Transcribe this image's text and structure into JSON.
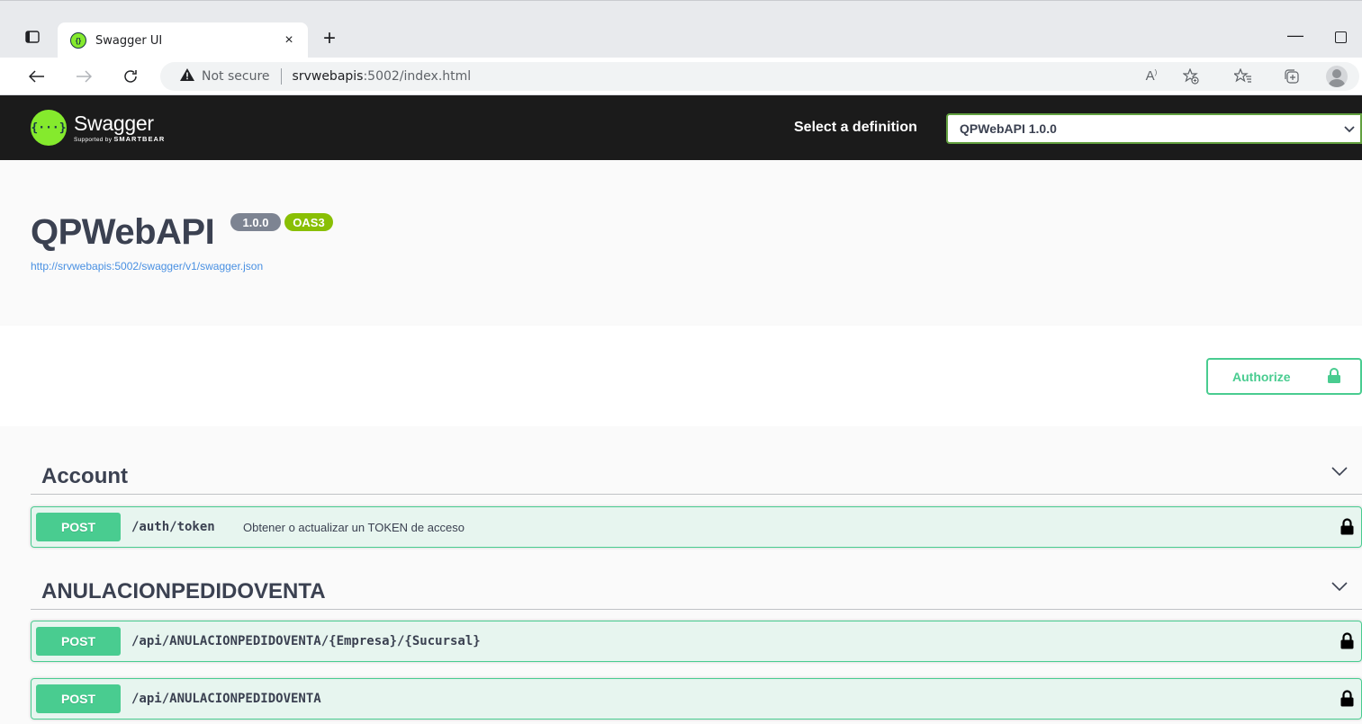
{
  "browser": {
    "tab_title": "Swagger UI",
    "tab_close": "×",
    "new_tab": "+",
    "minimize": "—",
    "security_label": "Not secure",
    "url_host": "srvwebapis",
    "url_rest": ":5002/index.html",
    "read_aloud_icon": "A",
    "icons": [
      "sidebar-toggle-icon",
      "back-arrow-icon",
      "forward-arrow-icon",
      "reload-icon",
      "warning-icon",
      "read-aloud-icon",
      "add-favorite-icon",
      "favorites-icon",
      "collections-icon",
      "profile-icon"
    ]
  },
  "topbar": {
    "logo_name": "Swagger",
    "logo_sub_prefix": "Supported by",
    "logo_sub_brand": "SMARTBEAR",
    "definition_label": "Select a definition",
    "definition_selected": "QPWebAPI 1.0.0",
    "accent": "#85ea2d"
  },
  "info": {
    "title": "QPWebAPI",
    "version": "1.0.0",
    "oas": "OAS3",
    "spec_url": "http://srvwebapis:5002/swagger/v1/swagger.json"
  },
  "authorize": {
    "label": "Authorize"
  },
  "tags": [
    {
      "name": "Account",
      "operations": [
        {
          "method": "POST",
          "path": "/auth/token",
          "summary": "Obtener o actualizar un TOKEN de acceso",
          "locked": true
        }
      ]
    },
    {
      "name": "ANULACIONPEDIDOVENTA",
      "operations": [
        {
          "method": "POST",
          "path": "/api/ANULACIONPEDIDOVENTA/{Empresa}/{Sucursal}",
          "summary": "",
          "locked": true
        },
        {
          "method": "POST",
          "path": "/api/ANULACIONPEDIDOVENTA",
          "summary": "",
          "locked": true
        }
      ]
    }
  ],
  "colors": {
    "post": "#49cc90",
    "topbar_bg": "#1b1b1b",
    "link": "#4990e2",
    "version_badge": "#7d8492",
    "oas_badge": "#89bf04"
  }
}
